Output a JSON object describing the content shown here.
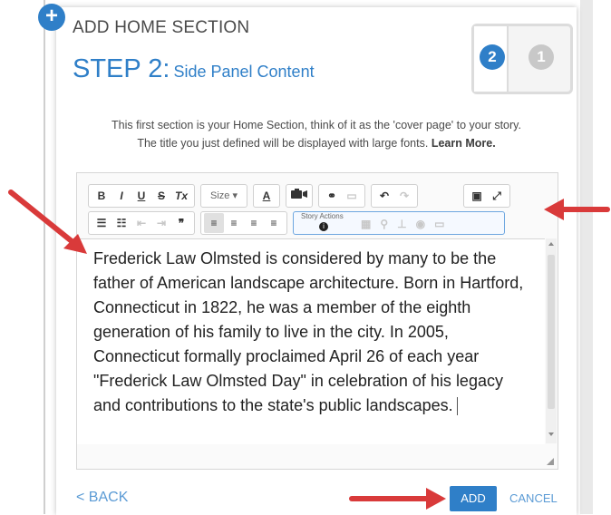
{
  "modal": {
    "title": "ADD HOME SECTION",
    "step_number": "STEP 2:",
    "step_subtitle": "Side Panel Content",
    "intro_line1": "This first section is your Home Section, think of it as the 'cover page' to your story.",
    "intro_line2": "The title you just defined will be displayed with large fonts.",
    "learn_more": "Learn More.",
    "step_indicator": {
      "active": "2",
      "inactive": "1"
    }
  },
  "toolbar": {
    "bold": "B",
    "italic": "I",
    "underline": "U",
    "strike": "S",
    "clear_format": "Tx",
    "size": "Size",
    "font_color": "A",
    "story_actions_label": "Story Actions",
    "story_actions_info": "i"
  },
  "content": {
    "text": "Frederick Law Olmsted is considered by many to be the father of American landscape architecture. Born in Hartford, Connecticut in 1822, he was a member of the eighth generation of his family to live in the city. In 2005, Connecticut formally proclaimed April 26 of each year \"Frederick Law Olmsted Day\" in celebration of his legacy and contributions to the state's public landscapes."
  },
  "footer": {
    "back": "< BACK",
    "add": "ADD",
    "cancel": "CANCEL"
  },
  "colors": {
    "accent": "#2f7fc8",
    "arrow": "#d93a3a"
  },
  "icons": [
    "plus-icon",
    "camera-icon",
    "link-icon",
    "undo-icon",
    "redo-icon",
    "source-icon",
    "fullscreen-icon",
    "numbered-list-icon",
    "bullet-list-icon",
    "quote-icon",
    "align-icon"
  ]
}
